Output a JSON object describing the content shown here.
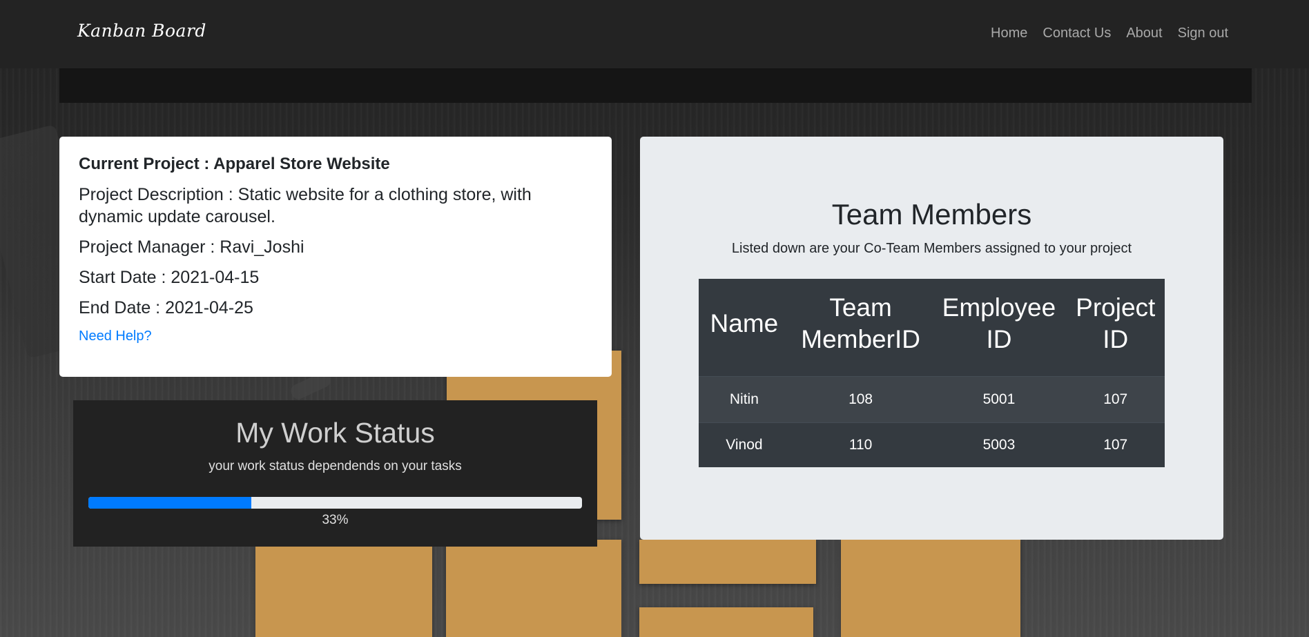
{
  "navbar": {
    "brand": "Kanban Board",
    "links": [
      "Home",
      "Contact Us",
      "About",
      "Sign out"
    ]
  },
  "project": {
    "title": "Current Project : Apparel Store Website",
    "description": "Project Description : Static website for a clothing store, with dynamic update carousel.",
    "manager": "Project Manager : Ravi_Joshi",
    "start_date": "Start Date : 2021-04-15",
    "end_date": "End Date : 2021-04-25",
    "help_link": "Need Help?"
  },
  "work_status": {
    "title": "My Work Status",
    "subtitle": "your work status dependends on your tasks",
    "progress_percent": 33,
    "progress_label": "33%"
  },
  "team": {
    "title": "Team Members",
    "subtitle": "Listed down are your Co-Team Members assigned to your project",
    "columns": [
      "Name",
      "Team MemberID",
      "Employee ID",
      "Project ID"
    ],
    "rows": [
      [
        "Nitin",
        "108",
        "5001",
        "107"
      ],
      [
        "Vinod",
        "110",
        "5003",
        "107"
      ]
    ]
  },
  "colors": {
    "accent": "#007bff",
    "navbar": "#232323",
    "table_header": "#343a40",
    "sticky_note": "#c8964f"
  }
}
